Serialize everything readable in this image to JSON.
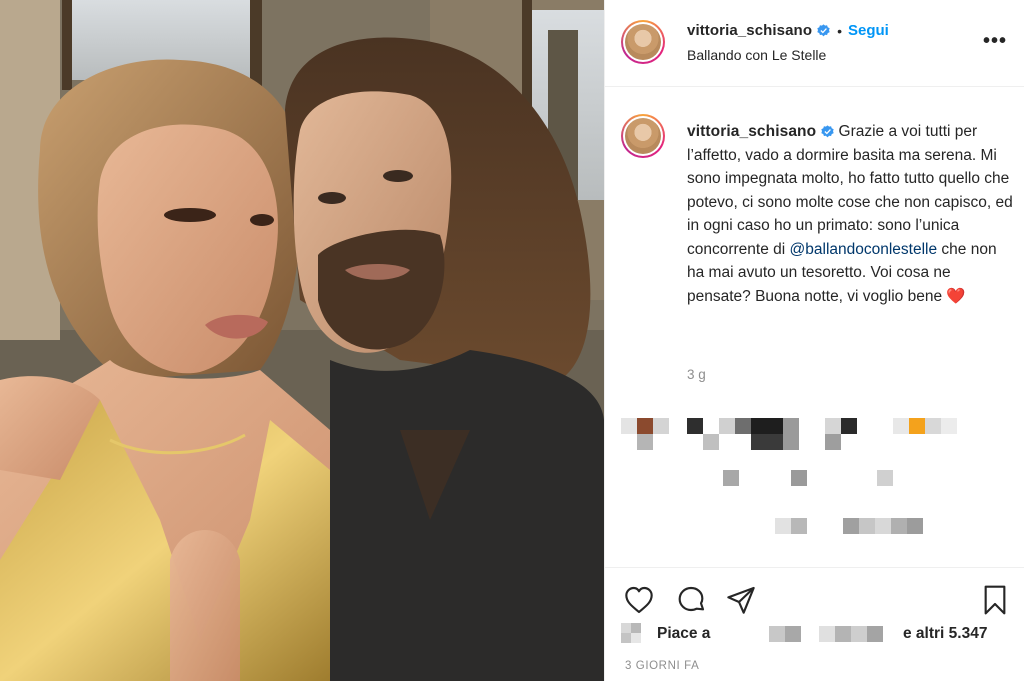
{
  "post": {
    "username": "vittoria_schisano",
    "follow_label": "Segui",
    "separator": "•",
    "location": "Ballando con Le Stelle",
    "more_icon": "•••"
  },
  "caption": {
    "username": "vittoria_schisano",
    "text_part1": "Grazie a voi tutti per l’affetto, vado a dormire basita ma serena. Mi sono impegnata molto, ho fatto tutto quello che potevo, ci sono molte cose che non capisco, ed in ogni caso ho un primato: sono l’unica concorrente di ",
    "mention": "@ballandoconlestelle",
    "text_part2": " che non ha mai avuto un tesoretto. Voi cosa ne pensate? Buona notte, vi voglio bene ",
    "heart": "❤️",
    "time": "3 g"
  },
  "likes": {
    "prefix": "Piace a",
    "suffix": "e altri 5.347"
  },
  "date_label": "3 GIORNI FA",
  "colors": {
    "accent": "#0095f6",
    "mention": "#00376b",
    "muted": "#8e8e8e",
    "heart": "#e0162b"
  },
  "icons": [
    "verified-badge-icon",
    "more-options-icon",
    "like-heart-icon",
    "comment-icon",
    "share-icon",
    "save-bookmark-icon"
  ]
}
